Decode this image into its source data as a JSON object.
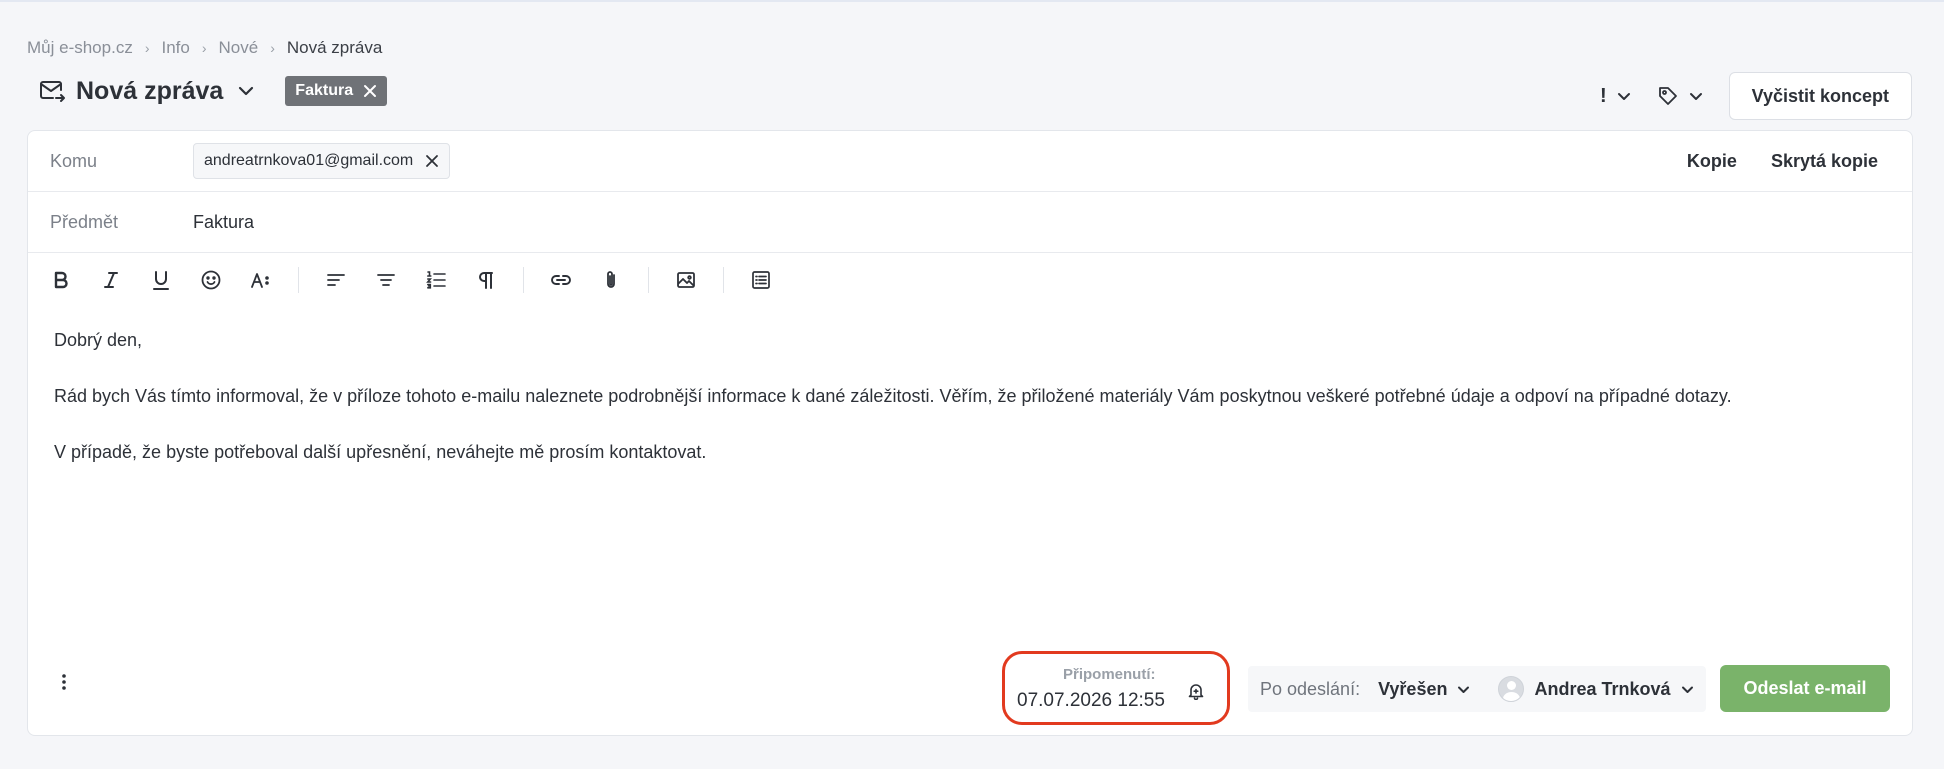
{
  "breadcrumb": {
    "items": [
      "Můj e-shop.cz",
      "Info",
      "Nové"
    ],
    "current": "Nová zpráva"
  },
  "header": {
    "title": "Nová zpráva",
    "tag": "Faktura",
    "priority_symbol": "!",
    "clear_draft_label": "Vyčistit koncept"
  },
  "compose": {
    "to_label": "Komu",
    "to_recipients": [
      "andreatrnkova01@gmail.com"
    ],
    "cc_label": "Kopie",
    "bcc_label": "Skrytá kopie",
    "subject_label": "Předmět",
    "subject_value": "Faktura"
  },
  "toolbar": {
    "icons": [
      "bold-icon",
      "italic-icon",
      "underline-icon",
      "emoji-icon",
      "font-size-icon",
      "align-left-icon",
      "align-center-icon",
      "ordered-list-icon",
      "paragraph-icon",
      "link-icon",
      "attachment-icon",
      "image-icon",
      "template-icon"
    ]
  },
  "body": {
    "paragraphs": [
      "Dobrý den,",
      "Rád bych Vás tímto informoval, že v příloze tohoto e-mailu naleznete podrobnější informace k dané záležitosti. Věřím, že přiložené materiály Vám poskytnou veškeré potřebné údaje a odpoví na případné dotazy.",
      "V případě, že byste potřeboval další upřesnění, neváhejte mě prosím kontaktovat."
    ]
  },
  "footer": {
    "reminder_label": "Připomenutí:",
    "reminder_value": "07.07.2026 12:55",
    "after_send_label": "Po odeslání:",
    "after_send_value": "Vyřešen",
    "assignee_name": "Andrea Trnková",
    "send_label": "Odeslat e-mail"
  },
  "colors": {
    "send_button": "#7ab36a",
    "highlight": "#e23a1f",
    "tag": "#6f7277"
  }
}
